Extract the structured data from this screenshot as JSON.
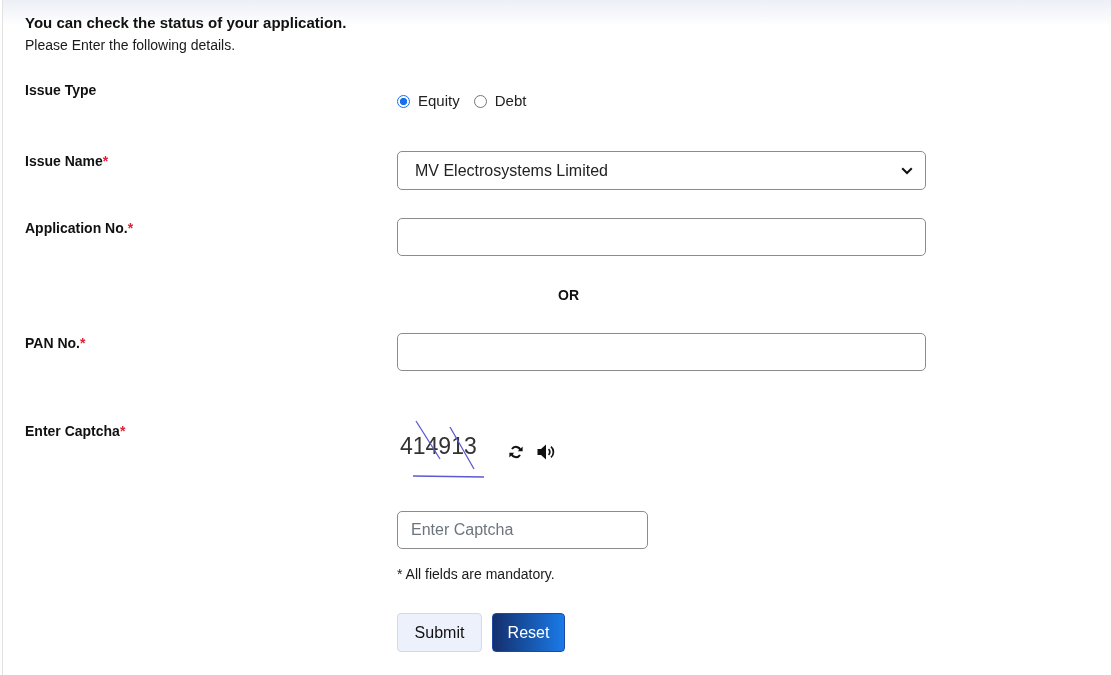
{
  "header": {
    "title": "You can check the status of your application.",
    "subtitle": "Please Enter the following details."
  },
  "form": {
    "fields": [
      {
        "kind": "radio",
        "label": "Issue Type",
        "options": [
          {
            "label": "Equity",
            "selected": true
          },
          {
            "label": "Debt",
            "selected": false
          }
        ]
      },
      {
        "kind": "select",
        "label": "Issue Name",
        "required_mark": "*",
        "value": "MV Electrosystems Limited"
      },
      {
        "kind": "text",
        "label": "Application No.",
        "required_mark": "*"
      },
      {
        "kind": "separator",
        "text": "OR"
      },
      {
        "kind": "text",
        "label": "PAN No.",
        "required_mark": "*"
      },
      {
        "kind": "captcha",
        "label": "Enter Captcha",
        "required_mark": "*",
        "captcha_text": "414913",
        "placeholder": "Enter Captcha"
      }
    ],
    "note": "* All fields are mandatory.",
    "buttons": [
      {
        "label": "Submit",
        "kind": "submit"
      },
      {
        "label": "Reset",
        "kind": "reset"
      }
    ]
  }
}
